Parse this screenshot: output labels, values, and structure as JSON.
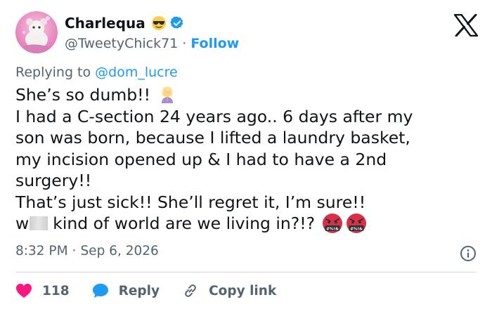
{
  "author": {
    "display_name": "Charlequa",
    "handle": "@TweetyChick71",
    "separator": "·",
    "follow_label": "Follow"
  },
  "reply_context": {
    "prefix": "Replying to",
    "mention": "@dom_lucre"
  },
  "tweet": {
    "line1": "She’s so dumb!!",
    "line2": "I had a C-section 24 years ago.. 6 days after my",
    "line3": "son was born, because I lifted a laundry basket,",
    "line4": "my incision opened up & I had to have a 2nd",
    "line5": "surgery!!",
    "line6": "That’s just sick!! She’ll regret it, I’m sure!!",
    "line7_start": "w",
    "line7_rest": "kind of world are we living in?!?"
  },
  "meta": {
    "time": "8:32 PM",
    "separator": "·",
    "date": "Sep 6, 2026"
  },
  "actions": {
    "likes": "118",
    "reply_label": "Reply",
    "copy_link_label": "Copy link"
  },
  "emoji_text": "#%!&",
  "colors": {
    "accent": "#1d9bf0",
    "like": "#f91880",
    "muted": "#536471"
  },
  "icons": [
    "sunglasses-emoji-icon",
    "verified-badge-icon",
    "x-logo-icon",
    "facepalm-emoji-icon",
    "cursing-face-emoji-icon",
    "info-icon",
    "heart-icon",
    "reply-bubble-icon",
    "link-icon"
  ]
}
